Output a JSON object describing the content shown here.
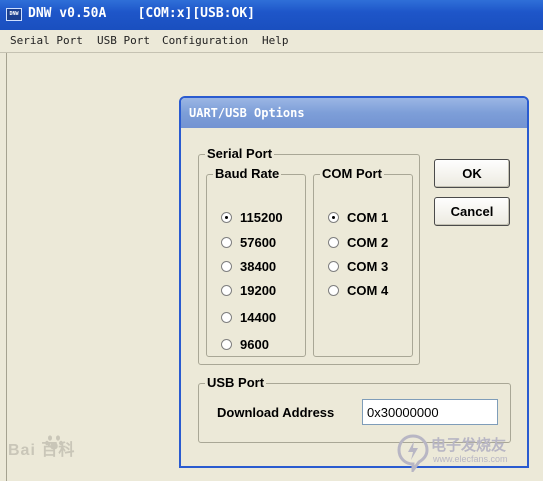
{
  "window": {
    "icon_label": "DNW",
    "title": "DNW v0.50A    [COM:x][USB:OK]"
  },
  "menu": {
    "items": [
      "Serial Port",
      "USB Port",
      "Configuration",
      "Help"
    ]
  },
  "dialog": {
    "title": "UART/USB Options",
    "serial_port": {
      "label": "Serial Port",
      "baud_rate": {
        "label": "Baud Rate",
        "options": [
          "115200",
          "57600",
          "38400",
          "19200",
          "14400",
          "9600"
        ],
        "selected": "115200"
      },
      "com_port": {
        "label": "COM Port",
        "options": [
          "COM 1",
          "COM 2",
          "COM 3",
          "COM 4"
        ],
        "selected": "COM 1"
      }
    },
    "usb_port": {
      "label": "USB Port",
      "download_address_label": "Download Address",
      "download_address_value": "0x30000000"
    },
    "buttons": {
      "ok": "OK",
      "cancel": "Cancel"
    }
  },
  "watermarks": {
    "left": "Bai  百科",
    "right_main": "电子发烧友",
    "right_sub": "www.elecfans.com"
  },
  "colors": {
    "titlebar": "#1e56c9",
    "dialog_titlebar": "#7d9ed8",
    "face": "#ece9d8"
  }
}
